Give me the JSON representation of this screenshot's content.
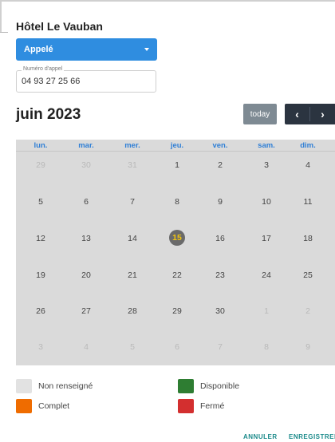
{
  "hotel_name": "Hôtel Le Vauban",
  "status_select": {
    "value": "Appelé",
    "icon": "chevron-down-icon"
  },
  "phone_field": {
    "label": "Numéro d'appel",
    "value": "04 93 27 25 66"
  },
  "calendar": {
    "month_title": "juin 2023",
    "today_label": "today",
    "prev_icon": "‹",
    "next_icon": "›",
    "weekdays": [
      "lun.",
      "mar.",
      "mer.",
      "jeu.",
      "ven.",
      "sam.",
      "dim."
    ],
    "weeks": [
      [
        "29",
        "30",
        "31",
        "1",
        "2",
        "3",
        "4"
      ],
      [
        "5",
        "6",
        "7",
        "8",
        "9",
        "10",
        "11"
      ],
      [
        "12",
        "13",
        "14",
        "15",
        "16",
        "17",
        "18"
      ],
      [
        "19",
        "20",
        "21",
        "22",
        "23",
        "24",
        "25"
      ],
      [
        "26",
        "27",
        "28",
        "29",
        "30",
        "1",
        "2"
      ],
      [
        "3",
        "4",
        "5",
        "6",
        "7",
        "8",
        "9"
      ]
    ],
    "today": "15",
    "accent_color": "#2f7fd6"
  },
  "legend": [
    {
      "label": "Non renseigné",
      "color": "#e2e2e2"
    },
    {
      "label": "Disponible",
      "color": "#2e7d32"
    },
    {
      "label": "Complet",
      "color": "#ef6c00"
    },
    {
      "label": "Fermé",
      "color": "#d32f2f"
    }
  ],
  "actions": {
    "cancel_label": "ANNULER",
    "save_label": "ENREGISTRER"
  }
}
